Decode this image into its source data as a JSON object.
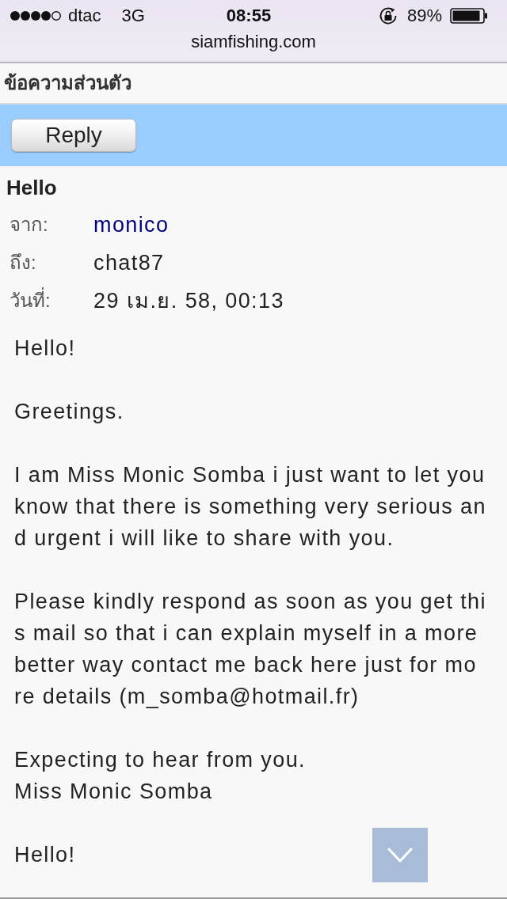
{
  "status_bar": {
    "carrier": "dtac",
    "network": "3G",
    "time": "08:55",
    "battery": "89%"
  },
  "address_bar": {
    "url": "siamfishing.com"
  },
  "page": {
    "title": "ข้อความส่วนตัว",
    "toolbar": {
      "buttons": [
        {
          "label": "Reply"
        }
      ]
    }
  },
  "message": {
    "subject": "Hello",
    "fields": [
      {
        "label": "จาก:",
        "value": "monico",
        "kind": "link"
      },
      {
        "label": "ถึง:",
        "value": "chat87",
        "kind": "text"
      },
      {
        "label": "วันที่:",
        "value": "29 เม.ย. 58, 00:13",
        "kind": "text"
      }
    ],
    "body": [
      {
        "lines": [
          "Hello!"
        ]
      },
      {
        "lines": [
          "Greetings."
        ]
      },
      {
        "lines": [
          "I am Miss Monic Somba i just want to let you",
          "know that there is something very serious an",
          "d urgent i will like to share with you."
        ]
      },
      {
        "lines": [
          "Please kindly respond as soon as you get thi",
          "s mail so that i can explain myself in a more",
          "better way contact me back here just for mo",
          "re details (m_somba@hotmail.fr)"
        ]
      },
      {
        "lines": [
          "Expecting to hear from you.",
          "Miss Monic Somba"
        ]
      },
      {
        "lines": [
          "Hello!"
        ]
      }
    ]
  }
}
